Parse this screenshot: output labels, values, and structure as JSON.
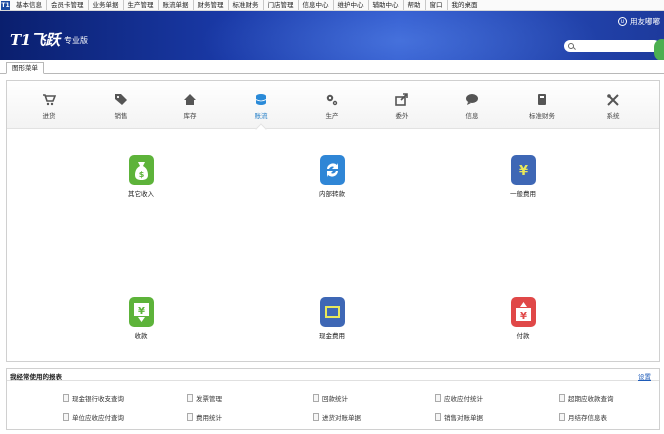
{
  "menubar": {
    "app_icon": "T1",
    "items": [
      "基本信息",
      "会员卡管理",
      "业务单据",
      "生产管理",
      "账流单据",
      "财务管理",
      "标准财务",
      "门店管理",
      "信息中心",
      "维护中心",
      "辅助中心",
      "帮助",
      "窗口",
      "我的桌面"
    ]
  },
  "banner": {
    "logo": "T1飞跃",
    "edition": "专业版",
    "brand": "用友嘟嘟",
    "search_placeholder": ""
  },
  "tabs": [
    "图形菜单"
  ],
  "modules": [
    {
      "label": "进货",
      "icon": "cart-icon"
    },
    {
      "label": "销售",
      "icon": "tag-icon"
    },
    {
      "label": "库存",
      "icon": "home-icon"
    },
    {
      "label": "账流",
      "icon": "coins-icon",
      "active": true
    },
    {
      "label": "生产",
      "icon": "gears-icon"
    },
    {
      "label": "委外",
      "icon": "share-icon"
    },
    {
      "label": "信息",
      "icon": "chat-icon"
    },
    {
      "label": "标准财务",
      "icon": "book-icon"
    },
    {
      "label": "系统",
      "icon": "tools-icon"
    }
  ],
  "functions": [
    {
      "label": "其它收入",
      "icon": "money-bag-icon",
      "color": "#5db33a"
    },
    {
      "label": "内部转款",
      "icon": "refresh-icon",
      "color": "#2f86d6"
    },
    {
      "label": "一般费用",
      "icon": "yen-icon",
      "color": "#3e67b5"
    },
    {
      "label": "收款",
      "icon": "yen-down-icon",
      "color": "#5db33a"
    },
    {
      "label": "现金费用",
      "icon": "cash-icon",
      "color": "#3e67b5"
    },
    {
      "label": "付款",
      "icon": "yen-up-icon",
      "color": "#e04848"
    }
  ],
  "frequent": {
    "title": "我经常使用的报表",
    "settings": "设置",
    "links": [
      [
        "现金银行收支查询",
        "发票管理",
        "回款统计",
        "应收应付统计",
        "超期应收款查询"
      ],
      [
        "单位应收应付查询",
        "费用统计",
        "进货对账单据",
        "销售对账单据",
        "月结存信息表"
      ]
    ]
  },
  "colors": {
    "accent": "#1e7bc6",
    "banner": "#1a3aa8"
  }
}
